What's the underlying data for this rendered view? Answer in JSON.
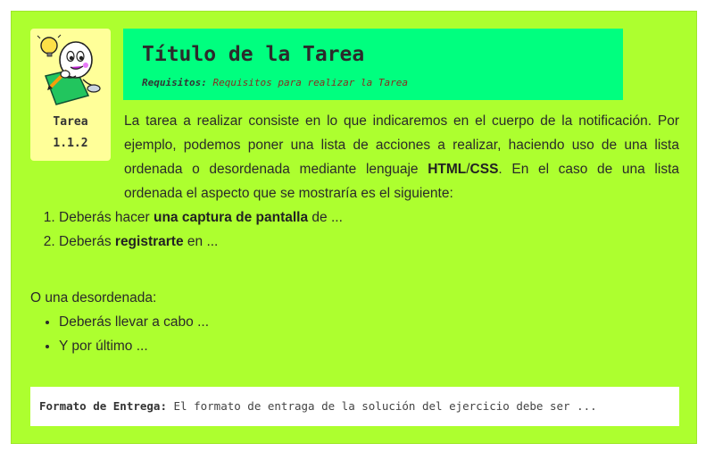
{
  "task": {
    "label": "Tarea",
    "number": "1.1.2",
    "icon": "student-writing-icon",
    "title": "Título de la Tarea",
    "requirements_label": "Requisitos:",
    "requirements_value": "Requisitos para realizar la Tarea"
  },
  "body": {
    "intro_start": "La tarea a realizar consiste en lo que indicaremos en el cuerpo de la notificación. Por ejemplo, podemos poner una lista de acciones a realizar, haciendo uso de una lista ordenada o desordenada mediante lenguaje ",
    "intro_html": "HTML",
    "intro_slash": "/",
    "intro_css": "CSS",
    "intro_end": ". En el caso de una lista ordenada el aspecto que se mostraría es el siguiente:",
    "ordered_items": [
      {
        "prefix": "Deberás hacer ",
        "bold": "una captura de pantalla",
        "suffix": " de ..."
      },
      {
        "prefix": "Deberás ",
        "bold": "registrarte",
        "suffix": " en ..."
      }
    ],
    "unordered_intro": "O una desordenada:",
    "unordered_items": [
      "Deberás llevar a cabo ...",
      "Y por último ..."
    ]
  },
  "delivery": {
    "label": "Formato de Entrega:",
    "text": " El formato de entraga de la solución del ejercicio debe ser ..."
  },
  "colors": {
    "card_background": "#adff2f",
    "header_background": "#00ff7f",
    "icon_box_background": "#ffff99",
    "requirements_value": "#8b2a1f"
  }
}
